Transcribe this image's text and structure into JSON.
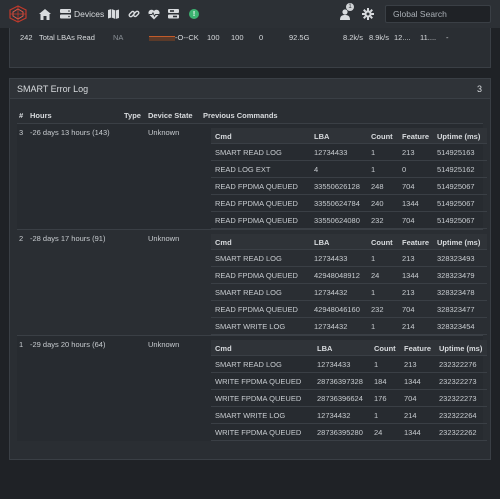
{
  "nav": {
    "devices_label": "Devices",
    "notification_count": "1",
    "search_placeholder": "Global Search",
    "status_badge": "!"
  },
  "attribute": {
    "id": "242",
    "name": "Total LBAs Read",
    "type": "NA",
    "flags": "-O--CK",
    "value": "100",
    "worst": "100",
    "thresh": "0",
    "raw": "92.5G",
    "rate1": "8.2k/s",
    "rate2": "8.9k/s",
    "col_a": "12....",
    "col_b": "11....",
    "col_c": "-"
  },
  "panel": {
    "title": "SMART Error Log",
    "count": "3",
    "columns": {
      "num": "#",
      "hours": "Hours",
      "type": "Type",
      "state": "Device State",
      "commands": "Previous Commands"
    },
    "sub_columns": {
      "cmd": "Cmd",
      "lba": "LBA",
      "count": "Count",
      "feature": "Feature",
      "uptime": "Uptime (ms)"
    },
    "errors": [
      {
        "num": "3",
        "hours": "-26 days 13 hours (143)",
        "type": "",
        "state": "Unknown",
        "commands": [
          {
            "cmd": "SMART READ LOG",
            "lba": "12734433",
            "count": "1",
            "feature": "213",
            "uptime": "514925163"
          },
          {
            "cmd": "READ LOG EXT",
            "lba": "4",
            "count": "1",
            "feature": "0",
            "uptime": "514925162"
          },
          {
            "cmd": "READ FPDMA QUEUED",
            "lba": "33550626128",
            "count": "248",
            "feature": "704",
            "uptime": "514925067"
          },
          {
            "cmd": "READ FPDMA QUEUED",
            "lba": "33550624784",
            "count": "240",
            "feature": "1344",
            "uptime": "514925067"
          },
          {
            "cmd": "READ FPDMA QUEUED",
            "lba": "33550624080",
            "count": "232",
            "feature": "704",
            "uptime": "514925067"
          }
        ]
      },
      {
        "num": "2",
        "hours": "-28 days 17 hours (91)",
        "type": "",
        "state": "Unknown",
        "commands": [
          {
            "cmd": "SMART READ LOG",
            "lba": "12734433",
            "count": "1",
            "feature": "213",
            "uptime": "328323493"
          },
          {
            "cmd": "READ FPDMA QUEUED",
            "lba": "42948048912",
            "count": "24",
            "feature": "1344",
            "uptime": "328323479"
          },
          {
            "cmd": "SMART READ LOG",
            "lba": "12734432",
            "count": "1",
            "feature": "213",
            "uptime": "328323478"
          },
          {
            "cmd": "READ FPDMA QUEUED",
            "lba": "42948046160",
            "count": "232",
            "feature": "704",
            "uptime": "328323477"
          },
          {
            "cmd": "SMART WRITE LOG",
            "lba": "12734432",
            "count": "1",
            "feature": "214",
            "uptime": "328323454"
          }
        ]
      },
      {
        "num": "1",
        "hours": "-29 days 20 hours (64)",
        "type": "",
        "state": "Unknown",
        "commands": [
          {
            "cmd": "SMART READ LOG",
            "lba": "12734433",
            "count": "1",
            "feature": "213",
            "uptime": "232322276"
          },
          {
            "cmd": "WRITE FPDMA QUEUED",
            "lba": "28736397328",
            "count": "184",
            "feature": "1344",
            "uptime": "232322273"
          },
          {
            "cmd": "WRITE FPDMA QUEUED",
            "lba": "28736396624",
            "count": "176",
            "feature": "704",
            "uptime": "232322273"
          },
          {
            "cmd": "SMART WRITE LOG",
            "lba": "12734432",
            "count": "1",
            "feature": "214",
            "uptime": "232322264"
          },
          {
            "cmd": "WRITE FPDMA QUEUED",
            "lba": "28736395280",
            "count": "24",
            "feature": "1344",
            "uptime": "232322262"
          }
        ]
      }
    ]
  }
}
